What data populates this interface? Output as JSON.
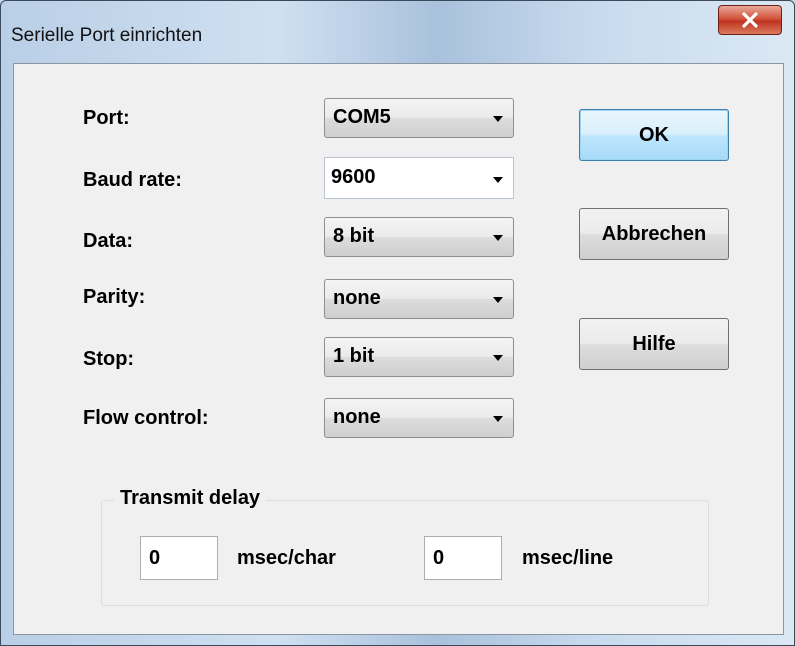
{
  "window": {
    "title": "Serielle Port einrichten"
  },
  "fields": [
    {
      "label": "Port:",
      "value": "COM5"
    },
    {
      "label": "Baud rate:",
      "value": "9600"
    },
    {
      "label": "Data:",
      "value": "8 bit"
    },
    {
      "label": "Parity:",
      "value": "none"
    },
    {
      "label": "Stop:",
      "value": "1 bit"
    },
    {
      "label": "Flow control:",
      "value": "none"
    }
  ],
  "buttons": {
    "ok": "OK",
    "cancel": "Abbrechen",
    "help": "Hilfe"
  },
  "transmit_delay": {
    "title": "Transmit delay",
    "char_value": "0",
    "char_unit": "msec/char",
    "line_value": "0",
    "line_unit": "msec/line"
  },
  "icons": {
    "close": "close-icon",
    "dropdown": "chevron-down-icon"
  },
  "colors": {
    "close_button": "#c9402a",
    "default_button": "#bee6fd",
    "dialog_background": "#f0f0f0"
  }
}
